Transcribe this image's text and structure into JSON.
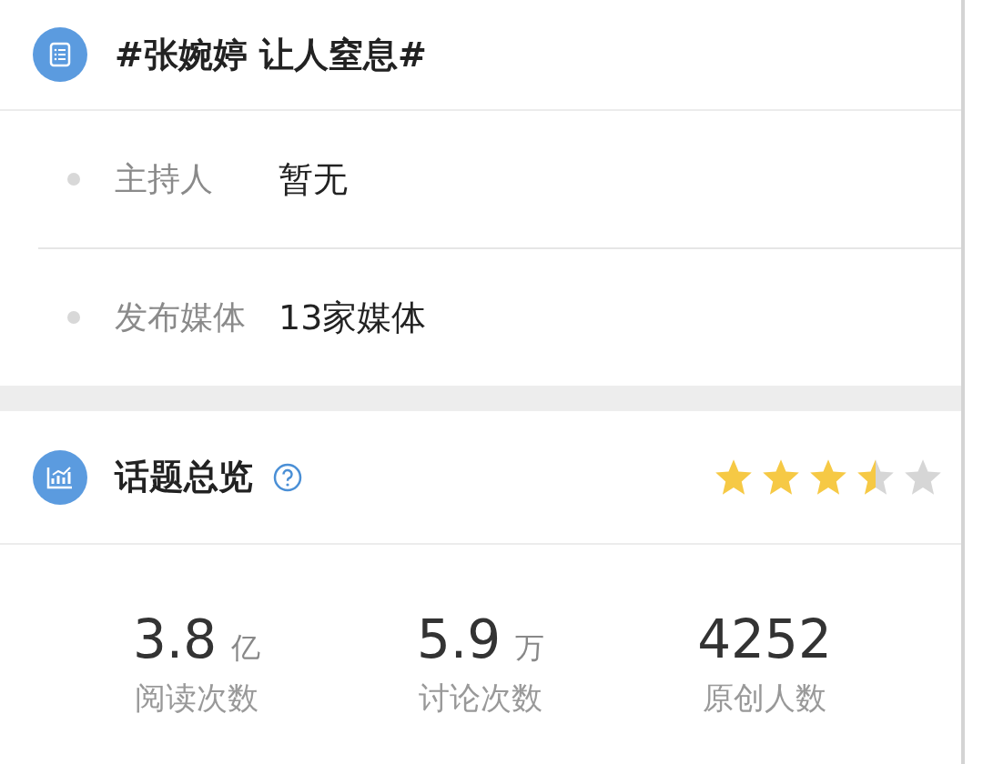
{
  "topic": {
    "title": "#张婉婷 让人窒息#"
  },
  "info_rows": [
    {
      "label": "主持人",
      "value": "暂无"
    },
    {
      "label": "发布媒体",
      "value": "13家媒体"
    }
  ],
  "overview": {
    "title": "话题总览",
    "stars": 3.5,
    "stats": [
      {
        "number": "3.8",
        "unit": "亿",
        "label": "阅读次数"
      },
      {
        "number": "5.9",
        "unit": "万",
        "label": "讨论次数"
      },
      {
        "number": "4252",
        "label": "原创人数"
      }
    ]
  }
}
